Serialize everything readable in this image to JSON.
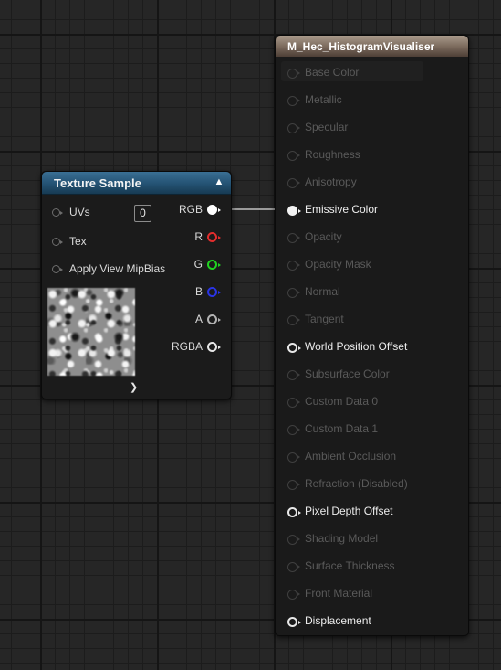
{
  "texture_node": {
    "title": "Texture Sample",
    "inputs": [
      {
        "label": "UVs",
        "value": "0"
      },
      {
        "label": "Tex"
      },
      {
        "label": "Apply View MipBias"
      }
    ],
    "outputs": [
      {
        "label": "RGB",
        "color": "#ffffff",
        "connected": true
      },
      {
        "label": "R",
        "color": "#e22d2d"
      },
      {
        "label": "G",
        "color": "#21d321"
      },
      {
        "label": "B",
        "color": "#2a34e6"
      },
      {
        "label": "A",
        "color": "#b3b3b3"
      },
      {
        "label": "RGBA",
        "color": "#e6e6e6"
      }
    ],
    "collapse_icon": "chevron-up-icon",
    "expand_icon": "chevron-down-icon"
  },
  "material_node": {
    "title": "M_Hec_HistogramVisualiser",
    "inputs": [
      {
        "label": "Base Color",
        "state": "dim"
      },
      {
        "label": "Metallic",
        "state": "dim"
      },
      {
        "label": "Specular",
        "state": "dim"
      },
      {
        "label": "Roughness",
        "state": "dim"
      },
      {
        "label": "Anisotropy",
        "state": "dim"
      },
      {
        "label": "Emissive Color",
        "state": "connected"
      },
      {
        "label": "Opacity",
        "state": "dim"
      },
      {
        "label": "Opacity Mask",
        "state": "dim"
      },
      {
        "label": "Normal",
        "state": "dim"
      },
      {
        "label": "Tangent",
        "state": "dim"
      },
      {
        "label": "World Position Offset",
        "state": "active"
      },
      {
        "label": "Subsurface Color",
        "state": "dim"
      },
      {
        "label": "Custom Data 0",
        "state": "dim"
      },
      {
        "label": "Custom Data 1",
        "state": "dim"
      },
      {
        "label": "Ambient Occlusion",
        "state": "dim"
      },
      {
        "label": "Refraction (Disabled)",
        "state": "dim"
      },
      {
        "label": "Pixel Depth Offset",
        "state": "active"
      },
      {
        "label": "Shading Model",
        "state": "dim"
      },
      {
        "label": "Surface Thickness",
        "state": "dim"
      },
      {
        "label": "Front Material",
        "state": "dim"
      },
      {
        "label": "Displacement",
        "state": "active"
      }
    ]
  }
}
